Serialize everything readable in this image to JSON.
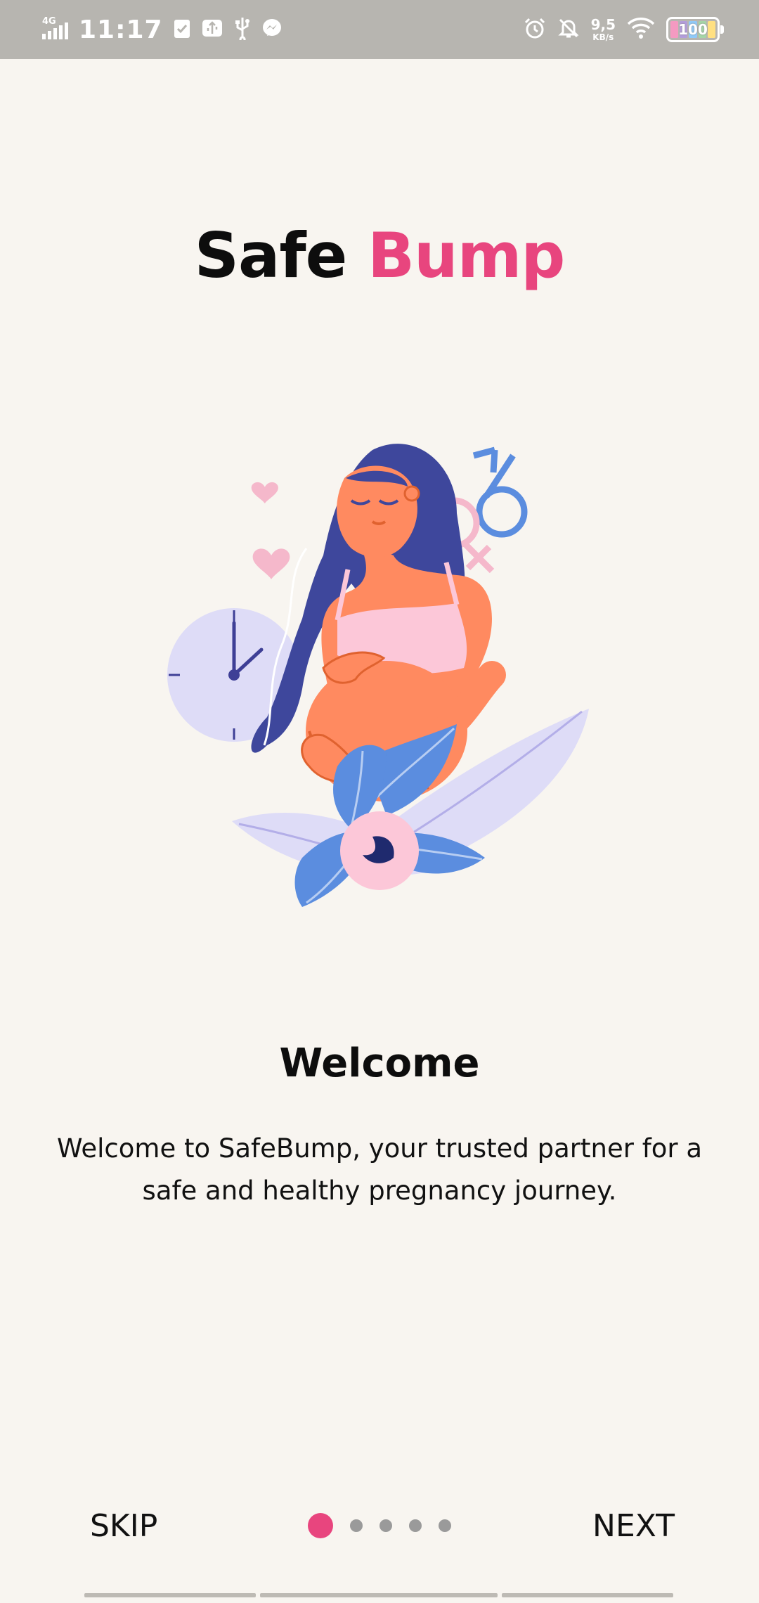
{
  "status_bar": {
    "network": "4G",
    "time": "11:17",
    "net_speed_value": "9,5",
    "net_speed_unit": "KB/s",
    "battery_level": "100",
    "icons": [
      "signal-icon",
      "clipboard-check-icon",
      "usb-debug-icon",
      "usb-icon",
      "messenger-icon",
      "alarm-icon",
      "bell-off-icon",
      "wifi-icon",
      "battery-icon"
    ]
  },
  "app": {
    "title_part1": "Safe",
    "title_part2": "Bump",
    "brand_color": "#e8457e"
  },
  "slide": {
    "title": "Welcome",
    "description": "Welcome to SafeBump, your trusted partner for a safe and healthy pregnancy journey."
  },
  "navigation": {
    "skip_label": "SKIP",
    "next_label": "NEXT",
    "page_count": 5,
    "current_page": 1
  }
}
